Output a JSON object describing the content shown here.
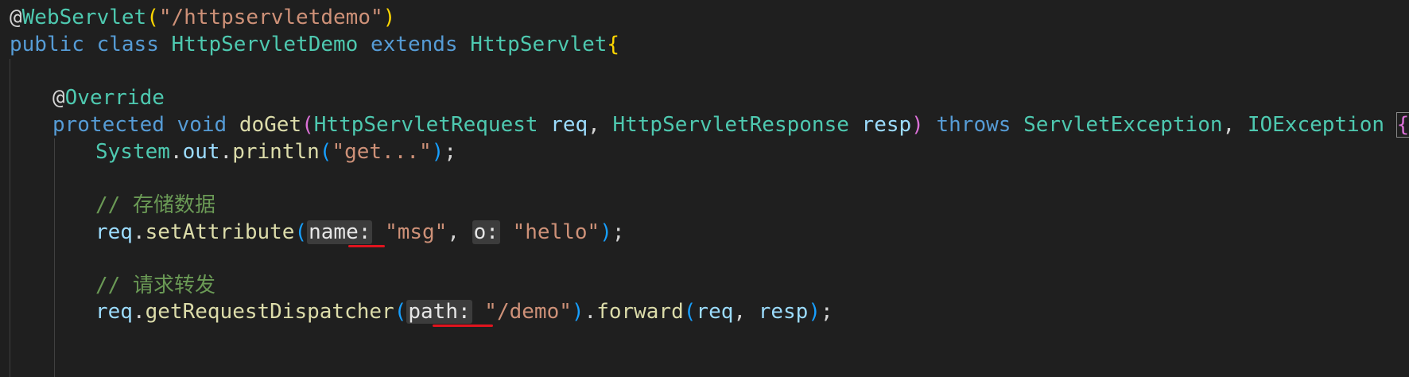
{
  "code": {
    "line1": {
      "at": "@",
      "annotation": "WebServlet",
      "paren_open": "(",
      "string": "\"/httpservletdemo\"",
      "paren_close": ")"
    },
    "line2": {
      "kw_public": "public",
      "kw_class": "class",
      "class_name": "HttpServletDemo",
      "kw_extends": "extends",
      "super_name": "HttpServlet",
      "brace": "{"
    },
    "line4": {
      "at": "@",
      "annotation": "Override"
    },
    "line5": {
      "kw_protected": "protected",
      "kw_void": "void",
      "method": "doGet",
      "paren_open": "(",
      "param1_type": "HttpServletRequest",
      "param1_name": "req",
      "comma1": ",",
      "param2_type": "HttpServletResponse",
      "param2_name": "resp",
      "paren_close": ")",
      "kw_throws": "throws",
      "ex1": "ServletException",
      "comma2": ",",
      "ex2": "IOException",
      "brace": "{"
    },
    "line6": {
      "cls": "System",
      "dot1": ".",
      "field": "out",
      "dot2": ".",
      "method": "println",
      "paren_open": "(",
      "string": "\"get...\"",
      "paren_close": ")",
      "semi": ";"
    },
    "line8": {
      "comment": "// 存储数据"
    },
    "line9": {
      "obj": "req",
      "dot": ".",
      "method": "setAttribute",
      "paren_open": "(",
      "hint1": "name:",
      "string1": "\"msg\"",
      "comma": ",",
      "hint2": "o:",
      "string2": "\"hello\"",
      "paren_close": ")",
      "semi": ";"
    },
    "line11": {
      "comment": "// 请求转发"
    },
    "line12": {
      "obj": "req",
      "dot1": ".",
      "method1": "getRequestDispatcher",
      "paren_open1": "(",
      "hint": "path:",
      "string": "\"/demo\"",
      "paren_close1": ")",
      "dot2": ".",
      "method2": "forward",
      "paren_open2": "(",
      "arg1": "req",
      "comma": ",",
      "arg2": "resp",
      "paren_close2": ")",
      "semi": ";"
    }
  },
  "colors": {
    "background": "#1f1f1f",
    "keyword": "#569cd6",
    "type": "#4ec9b0",
    "function": "#dcdcaa",
    "string": "#ce9178",
    "variable": "#9cdcfe",
    "comment": "#6a9955",
    "bracket_level1": "#ffd700",
    "bracket_level2": "#da70d6",
    "bracket_level3": "#179fff",
    "underline": "#e0141e"
  }
}
